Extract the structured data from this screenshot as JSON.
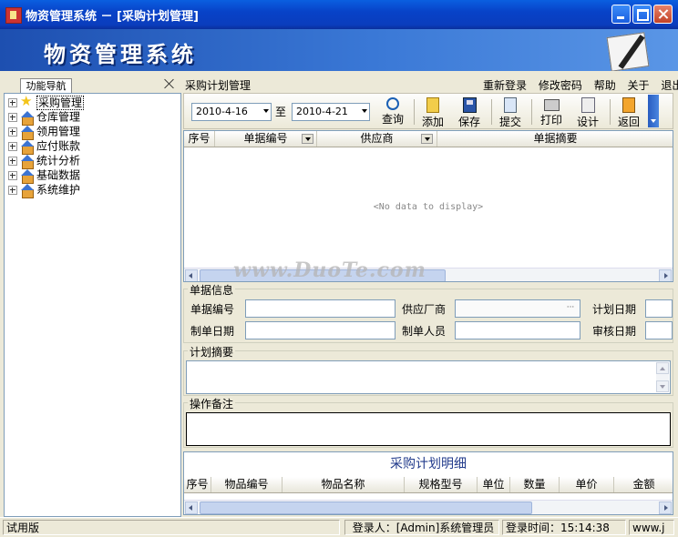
{
  "window": {
    "title": "物资管理系统 － [采购计划管理]"
  },
  "banner": {
    "app_name": "物资管理系统"
  },
  "nav": {
    "tab_label": "功能导航",
    "items": [
      {
        "label": "采购管理",
        "icon": "star-icon"
      },
      {
        "label": "仓库管理",
        "icon": "house-icon"
      },
      {
        "label": "领用管理",
        "icon": "house-icon"
      },
      {
        "label": "应付账款",
        "icon": "house-icon"
      },
      {
        "label": "统计分析",
        "icon": "house-icon"
      },
      {
        "label": "基础数据",
        "icon": "house-icon"
      },
      {
        "label": "系统维护",
        "icon": "house-icon"
      }
    ]
  },
  "page": {
    "title": "采购计划管理"
  },
  "top_menu": [
    "重新登录",
    "修改密码",
    "帮助",
    "关于",
    "退出"
  ],
  "toolbar": {
    "date_from": "2010-4-16",
    "to_label": "至",
    "date_to": "2010-4-21",
    "buttons": [
      "查询",
      "添加",
      "保存",
      "提交",
      "打印",
      "设计",
      "返回"
    ]
  },
  "main_grid": {
    "columns": [
      "序号",
      "单据编号",
      "供应商",
      "单据摘要"
    ],
    "empty_text": "<No data to display>"
  },
  "watermark": "www.DuoTe.com",
  "form": {
    "section_title": "单据信息",
    "labels": {
      "doc_no": "单据编号",
      "supplier": "供应厂商",
      "plan_date": "计划日期",
      "create_date": "制单日期",
      "creator": "制单人员",
      "audit_date": "审核日期"
    },
    "supplier_button": "···",
    "summary_title": "计划摘要",
    "remark_title": "操作备注"
  },
  "detail": {
    "title": "采购计划明细",
    "columns": [
      "序号",
      "物品编号",
      "物品名称",
      "规格型号",
      "单位",
      "数量",
      "单价",
      "金额"
    ]
  },
  "status": {
    "edition": "试用版",
    "login_user": "登录人：[Admin]系统管理员",
    "login_time": "登录时间：15:14:38",
    "url": "www.j"
  },
  "colors": {
    "title_bar": "#0a3dbd",
    "banner": "#3a78d6",
    "detail_title": "#223b8c"
  }
}
